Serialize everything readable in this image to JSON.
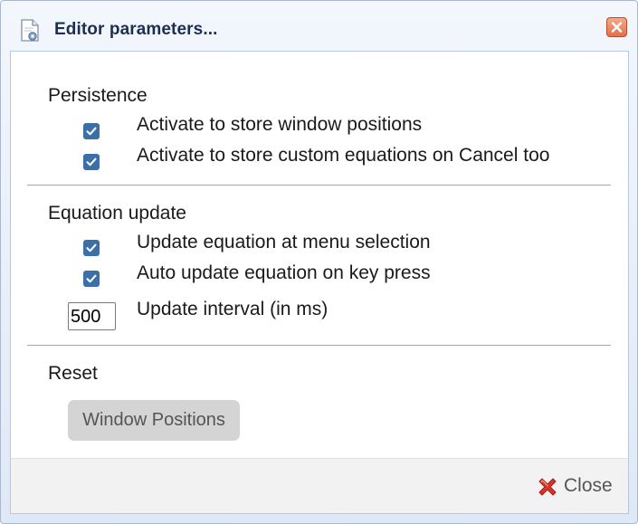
{
  "dialog": {
    "title": "Editor parameters...",
    "title_icon": "document-settings-icon",
    "close_icon": "close-icon"
  },
  "persistence": {
    "heading": "Persistence",
    "options": [
      {
        "label": "Activate to store window positions",
        "checked": true
      },
      {
        "label": "Activate to store custom equations on Cancel too",
        "checked": true
      }
    ]
  },
  "equation_update": {
    "heading": "Equation update",
    "options": [
      {
        "label": "Update equation at menu selection",
        "checked": true
      },
      {
        "label": "Auto update equation on key press",
        "checked": true
      }
    ],
    "interval_value": "500",
    "interval_label": "Update interval (in ms)"
  },
  "reset": {
    "heading": "Reset",
    "button_label": "Window Positions"
  },
  "footer": {
    "close_label": "Close",
    "close_icon": "red-x-icon"
  },
  "colors": {
    "checkbox": "#3b6fa8",
    "title_text": "#1c2f52",
    "close_x": "#cc2b1d"
  }
}
